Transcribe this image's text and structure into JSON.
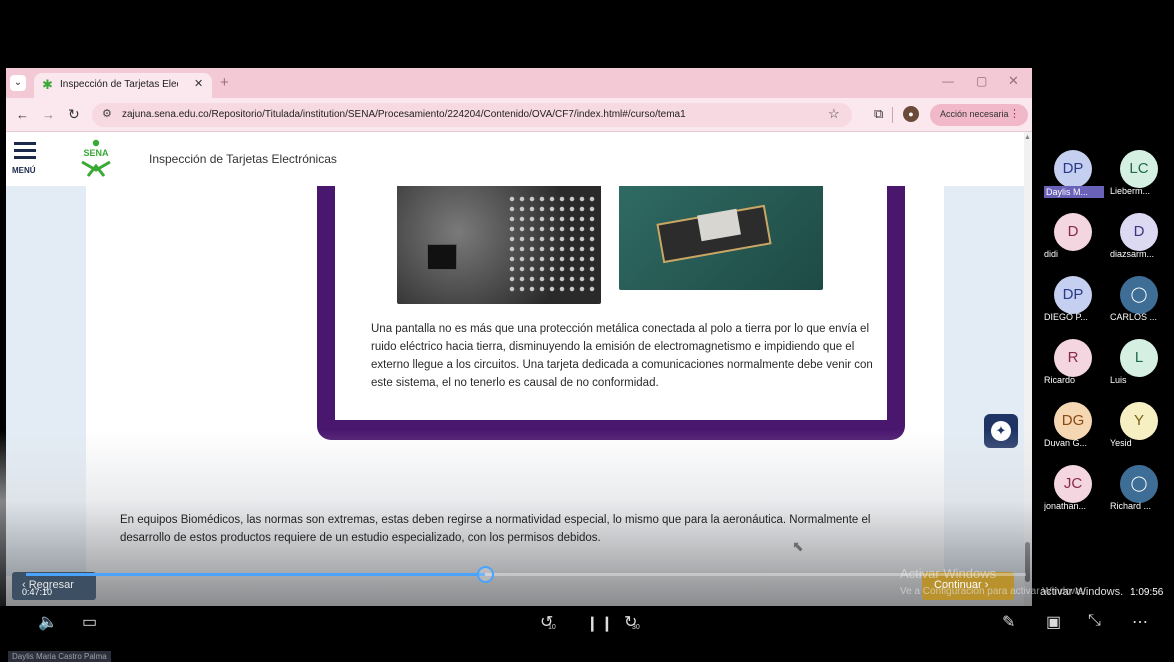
{
  "browser": {
    "tab_title": "Inspección de Tarjetas Electróni",
    "url": "zajuna.sena.edu.co/Repositorio/Titulada/institution/SENA/Procesamiento/224204/Contenido/OVA/CF7/index.html#/curso/tema1",
    "action_label": "Acción necesaria"
  },
  "page": {
    "menu_label": "MENÚ",
    "logo_text": "SENA",
    "course_title": "Inspección de Tarjetas Electrónicas",
    "card_text": "Una pantalla no es más que una protección metálica conectada al polo a tierra por lo que envía el ruido eléctrico hacia tierra, disminuyendo la emisión de electromagnetismo e impidiendo que el externo llegue a los circuitos. Una tarjeta dedicada a comunicaciones normalmente debe venir con este sistema, el no tenerlo es causal de no conformidad.",
    "caption_text": "En equipos Biomédicos, las normas son extremas, estas deben regirse a normatividad especial, lo mismo que para la aeronáutica. Normalmente el desarrollo de estos productos requiere de un estudio especializado, con los permisos debidos.",
    "back_label": "‹ Regresar",
    "continue_label": "Continuar  ›",
    "windows_line1": "Activar Windows",
    "windows_line2": "Ve a Configuración para activar Windows."
  },
  "player": {
    "time_current": "0:47:10",
    "time_total": "1:09:56",
    "progress": 0.4585,
    "skip_back": "10",
    "skip_fwd": "30",
    "presenter": "Daylis Maria Castro Palma"
  },
  "participants": [
    {
      "initials": "DP",
      "name": "Daylis M...",
      "bg": "#c5cff0",
      "fg": "#2a3a8c",
      "highlight": true
    },
    {
      "initials": "LC",
      "name": "Lieberm...",
      "bg": "#d6efe3",
      "fg": "#1f6b4a"
    },
    {
      "initials": "D",
      "name": "didi",
      "bg": "#f3d6df",
      "fg": "#8a2a48"
    },
    {
      "initials": "D",
      "name": "diazsarm...",
      "bg": "#dcd9f2",
      "fg": "#3c3580"
    },
    {
      "initials": "DP",
      "name": "DIEGO P...",
      "bg": "#c5cff0",
      "fg": "#2a3a8c"
    },
    {
      "initials": "",
      "name": "CARLOS ...",
      "bg": "#3e6d96",
      "fg": "#ffffff",
      "icon": "person-icon"
    },
    {
      "initials": "R",
      "name": "Ricardo",
      "bg": "#f3d6df",
      "fg": "#8a2a48"
    },
    {
      "initials": "L",
      "name": "Luis",
      "bg": "#d6efe3",
      "fg": "#1f6b4a"
    },
    {
      "initials": "DG",
      "name": "Duvan G...",
      "bg": "#f6d7b4",
      "fg": "#8a4a10"
    },
    {
      "initials": "Y",
      "name": "Yesid",
      "bg": "#f7efc4",
      "fg": "#7a6010"
    },
    {
      "initials": "JC",
      "name": "jonathan...",
      "bg": "#f3d6df",
      "fg": "#8a2a48"
    },
    {
      "initials": "",
      "name": "Richard ...",
      "bg": "#3e6d96",
      "fg": "#ffffff",
      "icon": "person-icon"
    }
  ]
}
